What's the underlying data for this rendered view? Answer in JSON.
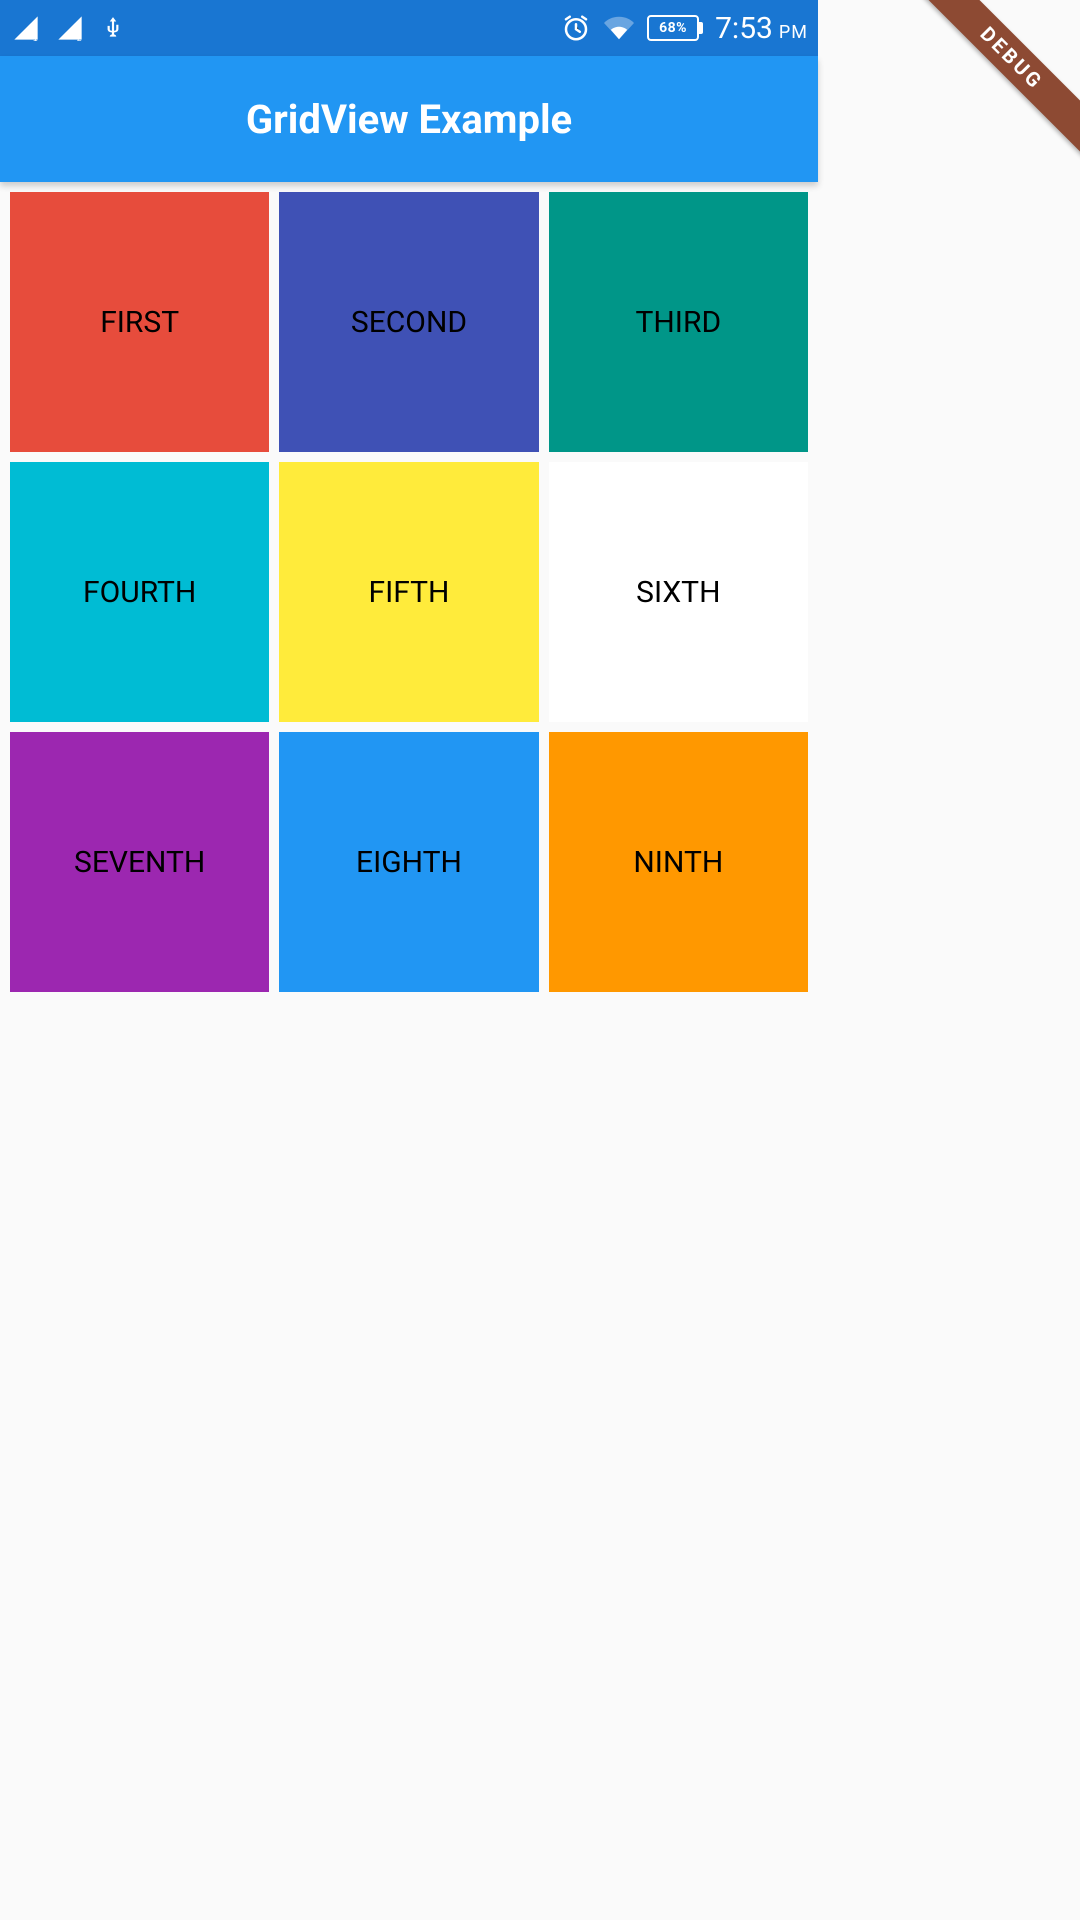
{
  "statusbar": {
    "battery_text": "68%",
    "time": "7:53",
    "ampm": "PM"
  },
  "debug_label": "DEBUG",
  "appbar": {
    "title": "GridView Example"
  },
  "grid": {
    "tiles": [
      {
        "label": "FIRST",
        "color": "#e74c3c"
      },
      {
        "label": "SECOND",
        "color": "#3f51b5"
      },
      {
        "label": "THIRD",
        "color": "#009688"
      },
      {
        "label": "FOURTH",
        "color": "#00bcd4"
      },
      {
        "label": "FIFTH",
        "color": "#ffeb3b"
      },
      {
        "label": "SIXTH",
        "color": "#ffffff"
      },
      {
        "label": "SEVENTH",
        "color": "#9c27b0"
      },
      {
        "label": "EIGHTH",
        "color": "#2196f3"
      },
      {
        "label": "NINTH",
        "color": "#ff9800"
      }
    ]
  }
}
